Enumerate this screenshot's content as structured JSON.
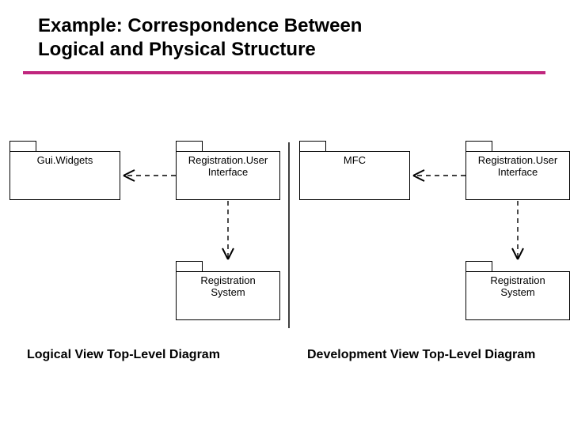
{
  "title_line1": "Example: Correspondence Between",
  "title_line2": "Logical and Physical Structure",
  "packages": {
    "guiwidgets": "Gui.Widgets",
    "reg_ui_left": "Registration.User\nInterface",
    "mfc": "MFC",
    "reg_ui_right": "Registration.User\nInterface",
    "reg_sys_left": "Registration\nSystem",
    "reg_sys_right": "Registration\nSystem"
  },
  "captions": {
    "left": "Logical View Top-Level Diagram",
    "right": "Development View Top-Level Diagram"
  },
  "colors": {
    "accent": "#c0267e"
  },
  "chart_data": {
    "type": "diagram",
    "diagram_kind": "uml-package",
    "views": [
      {
        "name": "Logical View Top-Level Diagram",
        "packages": [
          "Gui.Widgets",
          "Registration.User Interface",
          "Registration System"
        ],
        "dependencies": [
          {
            "from": "Registration.User Interface",
            "to": "Gui.Widgets"
          },
          {
            "from": "Registration.User Interface",
            "to": "Registration System"
          }
        ]
      },
      {
        "name": "Development View Top-Level Diagram",
        "packages": [
          "MFC",
          "Registration.User Interface",
          "Registration System"
        ],
        "dependencies": [
          {
            "from": "Registration.User Interface",
            "to": "MFC"
          },
          {
            "from": "Registration.User Interface",
            "to": "Registration System"
          }
        ]
      }
    ]
  }
}
